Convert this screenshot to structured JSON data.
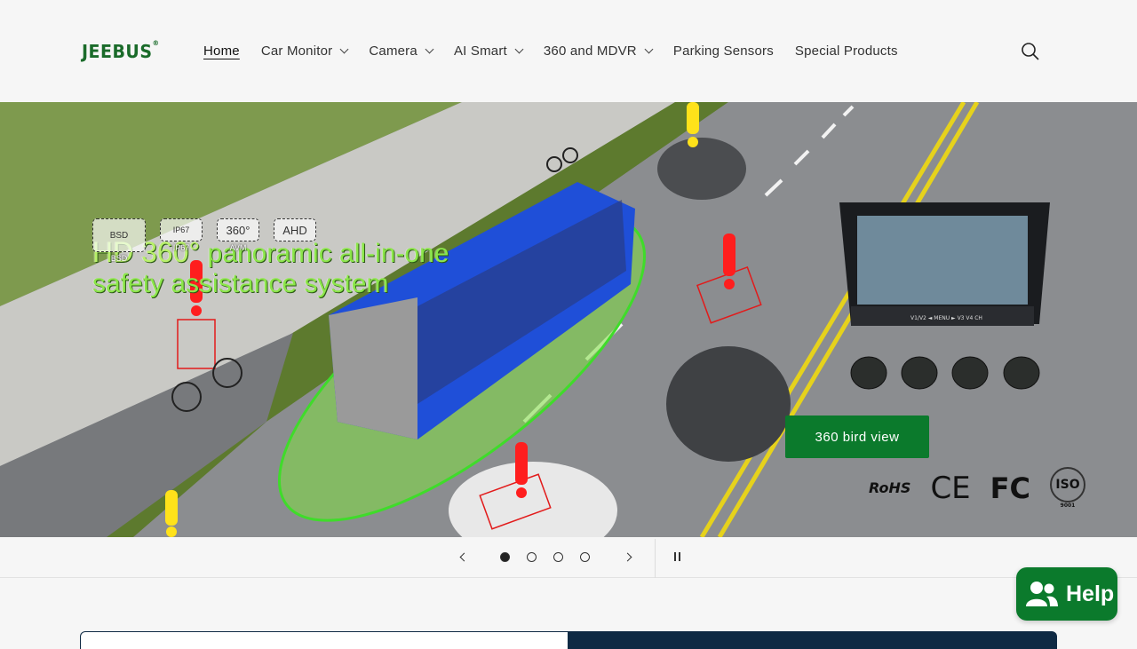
{
  "brand": {
    "logo_text": "JEEBUS",
    "logo_mark": "®"
  },
  "nav": {
    "items": [
      {
        "label": "Home",
        "dropdown": false,
        "active": true
      },
      {
        "label": "Car Monitor",
        "dropdown": true
      },
      {
        "label": "Camera",
        "dropdown": true
      },
      {
        "label": "AI Smart",
        "dropdown": true
      },
      {
        "label": "360 and MDVR",
        "dropdown": true
      },
      {
        "label": "Parking Sensors",
        "dropdown": false
      },
      {
        "label": "Special Products",
        "dropdown": false
      }
    ],
    "search_icon": "search-icon"
  },
  "hero": {
    "title_line1_a": "HD 360°",
    "title_line1_b": " panoramic all-in-one",
    "title_line2": "safety assistance system",
    "badges": [
      {
        "icon": "BSD",
        "caption": "BSD"
      },
      {
        "icon": "IP67",
        "caption": "IP67"
      },
      {
        "icon": "360°",
        "caption": "AVM"
      },
      {
        "icon": "AHD",
        "caption": ""
      }
    ],
    "cta_label": "360 bird view",
    "certifications": [
      "RoHS",
      "CE",
      "FC",
      "ISO",
      "9001"
    ],
    "monitor_text": "V1/V2 ◄ MENU ► V3 V4 CH"
  },
  "slider": {
    "prev_icon": "chevron-left-icon",
    "next_icon": "chevron-right-icon",
    "slide_count": 4,
    "active_slide": 1,
    "pause_icon": "pause-icon"
  },
  "chat": {
    "label": "Help",
    "icon": "person-icon"
  },
  "colors": {
    "brand_green": "#0b7a2c",
    "navy": "#0f2a44",
    "accent_lime": "#8ce64a"
  }
}
